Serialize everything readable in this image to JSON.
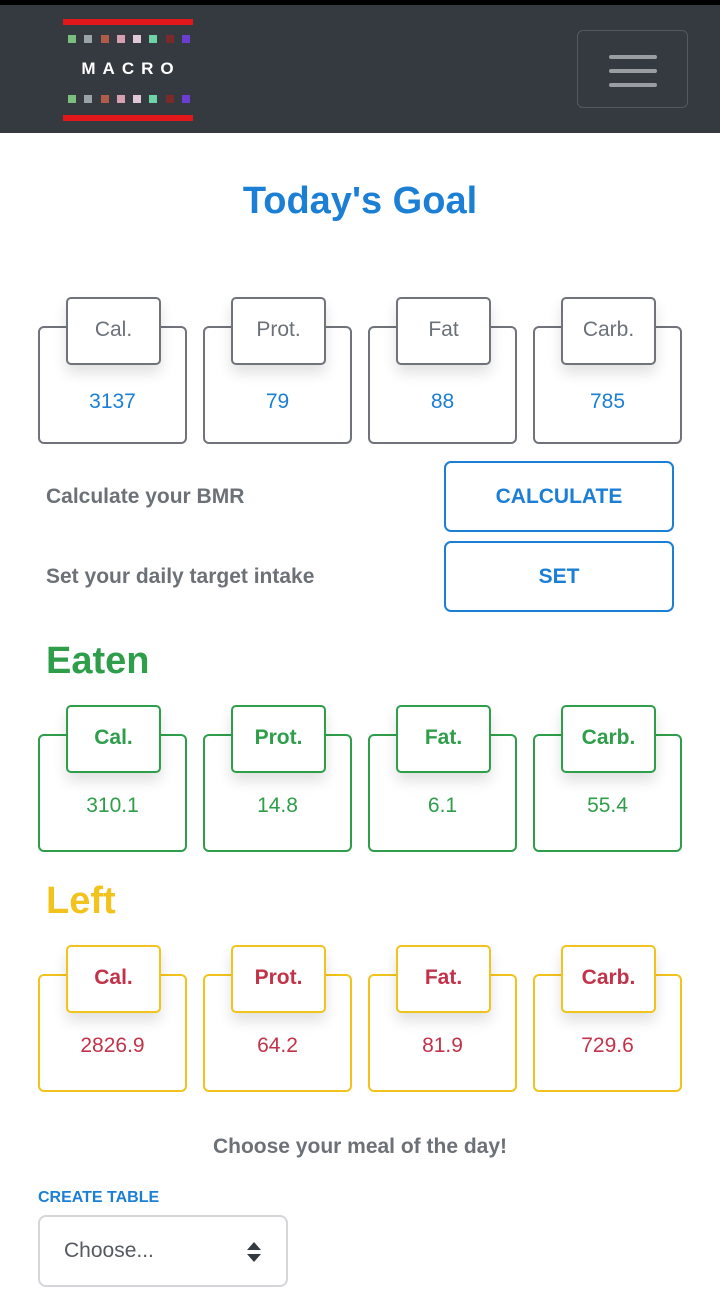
{
  "app": {
    "logo_text": "MACRO",
    "menu_icon": "hamburger-icon"
  },
  "colors": {
    "navbar": "#343a40",
    "primary": "#1c7fd6",
    "eaten": "#2e9e4a",
    "left_border": "#f2c31d",
    "left_text": "#c2334a",
    "logo_bar": "#e0171b"
  },
  "goal": {
    "title": "Today's Goal",
    "cards": [
      {
        "label": "Cal.",
        "value": "3137"
      },
      {
        "label": "Prot.",
        "value": "79"
      },
      {
        "label": "Fat",
        "value": "88"
      },
      {
        "label": "Carb.",
        "value": "785"
      }
    ]
  },
  "actions": {
    "bmr_label": "Calculate your BMR",
    "calculate_button": "CALCULATE",
    "target_label": "Set your daily target intake",
    "set_button": "SET"
  },
  "eaten": {
    "title": "Eaten",
    "cards": [
      {
        "label": "Cal.",
        "value": "310.1"
      },
      {
        "label": "Prot.",
        "value": "14.8"
      },
      {
        "label": "Fat.",
        "value": "6.1"
      },
      {
        "label": "Carb.",
        "value": "55.4"
      }
    ]
  },
  "left": {
    "title": "Left",
    "cards": [
      {
        "label": "Cal.",
        "value": "2826.9"
      },
      {
        "label": "Prot.",
        "value": "64.2"
      },
      {
        "label": "Fat.",
        "value": "81.9"
      },
      {
        "label": "Carb.",
        "value": "729.6"
      }
    ]
  },
  "meal": {
    "prompt": "Choose your meal of the day!",
    "create_table": "CREATE TABLE",
    "select_value": "Choose..."
  }
}
